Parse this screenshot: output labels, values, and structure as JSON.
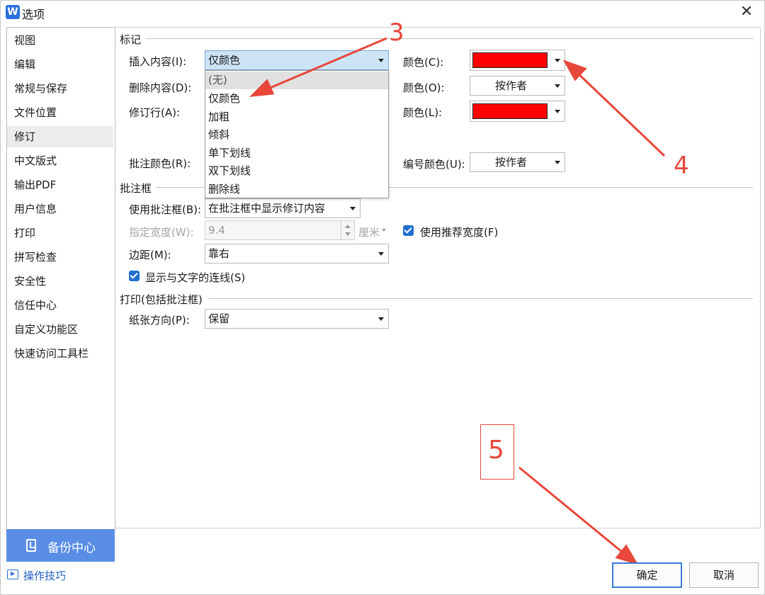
{
  "window": {
    "title": "选项",
    "app_logo": "W",
    "close_glyph": "✕"
  },
  "sidebar": {
    "items": [
      {
        "label": "视图"
      },
      {
        "label": "编辑"
      },
      {
        "label": "常规与保存"
      },
      {
        "label": "文件位置"
      },
      {
        "label": "修订",
        "active": true
      },
      {
        "label": "中文版式"
      },
      {
        "label": "输出PDF"
      },
      {
        "label": "用户信息"
      },
      {
        "label": "打印"
      },
      {
        "label": "拼写检查"
      },
      {
        "label": "安全性"
      },
      {
        "label": "信任中心"
      },
      {
        "label": "自定义功能区"
      },
      {
        "label": "快速访问工具栏"
      }
    ],
    "backup_label": "备份中心",
    "tips_label": "操作技巧"
  },
  "markup": {
    "title": "标记",
    "insert_label": "插入内容(I):",
    "insert_value": "仅颜色",
    "insert_options": [
      "(无)",
      "仅颜色",
      "加粗",
      "倾斜",
      "单下划线",
      "双下划线",
      "删除线"
    ],
    "delete_label": "删除内容(D):",
    "changed_line_label": "修订行(A):",
    "comment_color_label": "批注颜色(R):",
    "color_c_label": "颜色(C):",
    "color_c_value": "#ff0000",
    "color_o_label": "颜色(O):",
    "color_o_value": "按作者",
    "color_l_label": "颜色(L):",
    "color_l_value": "#ff0000",
    "number_color_label": "编号颜色(U):",
    "number_color_value": "按作者"
  },
  "balloons": {
    "title": "批注框",
    "use_label": "使用批注框(B):",
    "use_value": "在批注框中显示修订内容",
    "width_label": "指定宽度(W):",
    "width_value": "9.4",
    "width_unit": "厘米",
    "recommend_label": "使用推荐宽度(F)",
    "recommend_checked": true,
    "margin_label": "边距(M):",
    "margin_value": "靠右",
    "show_lines_label": "显示与文字的连线(S)",
    "show_lines_checked": true
  },
  "printing": {
    "title": "打印(包括批注框)",
    "orientation_label": "纸张方向(P):",
    "orientation_value": "保留"
  },
  "annotations": {
    "n3": "3",
    "n4": "4",
    "n5": "5",
    "color": "#e8473a"
  },
  "buttons": {
    "ok": "确定",
    "cancel": "取消"
  }
}
